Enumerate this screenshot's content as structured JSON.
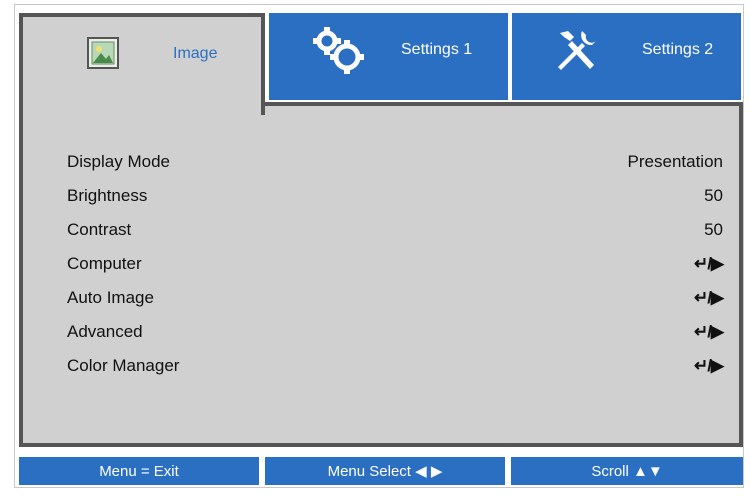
{
  "tabs": [
    {
      "label": "Image",
      "icon": "image-icon",
      "active": true
    },
    {
      "label": "Settings 1",
      "icon": "gears-icon",
      "active": false
    },
    {
      "label": "Settings 2",
      "icon": "tools-icon",
      "active": false
    }
  ],
  "menu": [
    {
      "label": "Display Mode",
      "value": "Presentation"
    },
    {
      "label": "Brightness",
      "value": "50"
    },
    {
      "label": "Contrast",
      "value": "50"
    },
    {
      "label": "Computer",
      "value": "↵/▶"
    },
    {
      "label": "Auto Image",
      "value": "↵/▶"
    },
    {
      "label": "Advanced",
      "value": "↵/▶"
    },
    {
      "label": "Color Manager",
      "value": "↵/▶"
    }
  ],
  "footer": {
    "exit": "Menu = Exit",
    "select": "Menu Select ◀ ▶",
    "scroll": "Scroll ▲▼"
  },
  "colors": {
    "accent": "#2b6fc2",
    "panel": "#d0d0d0",
    "border": "#555555"
  }
}
